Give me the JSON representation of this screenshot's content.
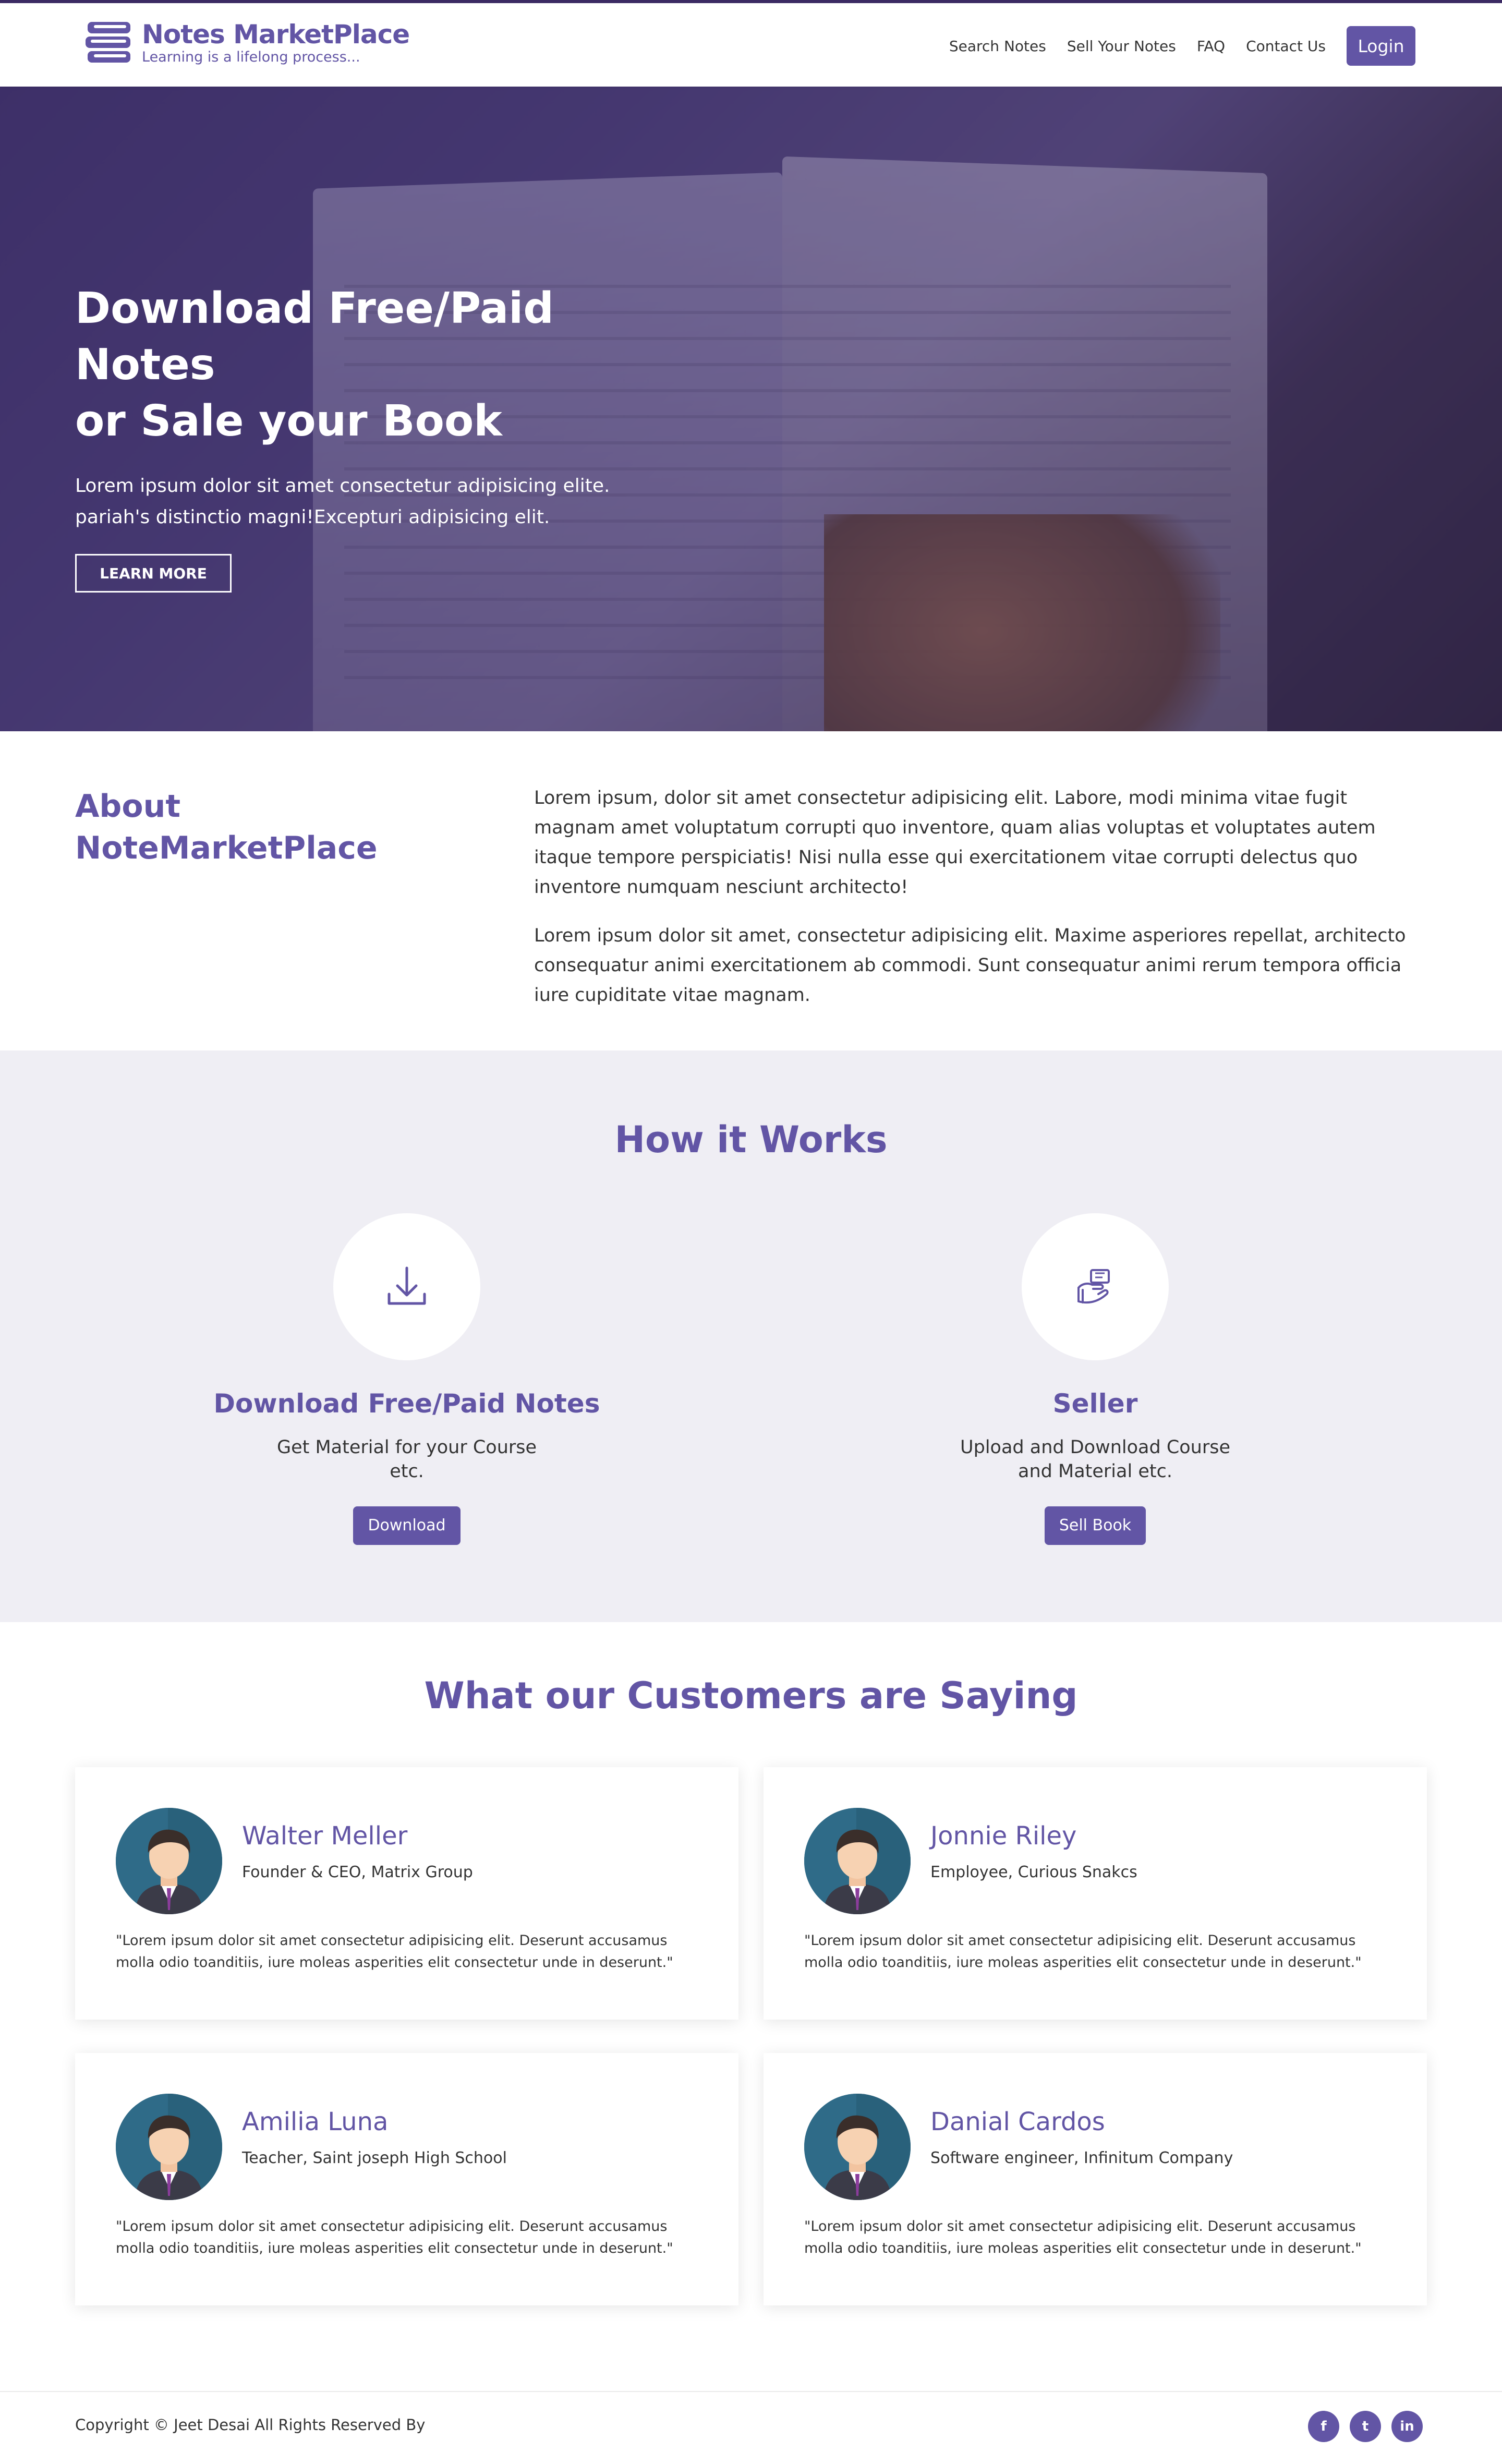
{
  "brand": {
    "title": "Notes MarketPlace",
    "tagline": "Learning is a lifelong process..."
  },
  "nav": {
    "links": [
      "Search Notes",
      "Sell Your Notes",
      "FAQ",
      "Contact Us"
    ],
    "login_label": "Login"
  },
  "hero": {
    "title_line1": "Download Free/Paid Notes",
    "title_line2": "or Sale your Book",
    "description": "Lorem ipsum dolor sit amet consectetur adipisicing elite. pariah's distinctio magni!Excepturi adipisicing elit.",
    "button_label": "LEARN MORE"
  },
  "about": {
    "title_line1": "About",
    "title_line2": "NoteMarketPlace",
    "paragraph1": "Lorem ipsum, dolor sit amet consectetur adipisicing elit. Labore, modi minima vitae fugit magnam amet voluptatum corrupti quo inventore, quam alias voluptas et voluptates autem itaque tempore perspiciatis! Nisi nulla esse qui exercitationem vitae corrupti delectus quo inventore numquam nesciunt architecto!",
    "paragraph2": "Lorem ipsum dolor sit amet, consectetur adipisicing elit. Maxime asperiores repellat, architecto consequatur animi exercitationem ab commodi. Sunt consequatur animi rerum tempora officia iure cupiditate vitae magnam."
  },
  "how": {
    "title": "How it Works",
    "items": [
      {
        "title": "Download Free/Paid Notes",
        "description": "Get Material for your Course etc.",
        "button": "Download",
        "icon": "download-icon"
      },
      {
        "title": "Seller",
        "description": "Upload and Download Course and Material etc.",
        "button": "Sell Book",
        "icon": "seller-icon"
      }
    ]
  },
  "testimonials": {
    "title": "What our Customers are Saying",
    "items": [
      {
        "name": "Walter Meller",
        "role": "Founder & CEO, Matrix Group",
        "quote": "\"Lorem ipsum dolor sit amet consectetur adipisicing elit. Deserunt accusamus molla odio toanditiis, iure moleas asperities elit consectetur unde in deserunt.\""
      },
      {
        "name": "Jonnie Riley",
        "role": "Employee, Curious Snakcs",
        "quote": "\"Lorem ipsum dolor sit amet consectetur adipisicing elit. Deserunt accusamus molla odio toanditiis, iure moleas asperities elit consectetur unde in deserunt.\""
      },
      {
        "name": "Amilia Luna",
        "role": "Teacher, Saint joseph High School",
        "quote": "\"Lorem ipsum dolor sit amet consectetur adipisicing elit. Deserunt accusamus molla odio toanditiis, iure moleas asperities elit consectetur unde in deserunt.\""
      },
      {
        "name": "Danial Cardos",
        "role": "Software engineer, Infinitum Company",
        "quote": "\"Lorem ipsum dolor sit amet consectetur adipisicing elit. Deserunt accusamus molla odio toanditiis, iure moleas asperities elit consectetur unde in deserunt.\""
      }
    ]
  },
  "footer": {
    "copyright": "Copyright © Jeet Desai All Rights Reserved By",
    "socials": [
      "f",
      "t",
      "in"
    ]
  },
  "colors": {
    "primary": "#6255a5",
    "section_bg": "#efeef4"
  }
}
